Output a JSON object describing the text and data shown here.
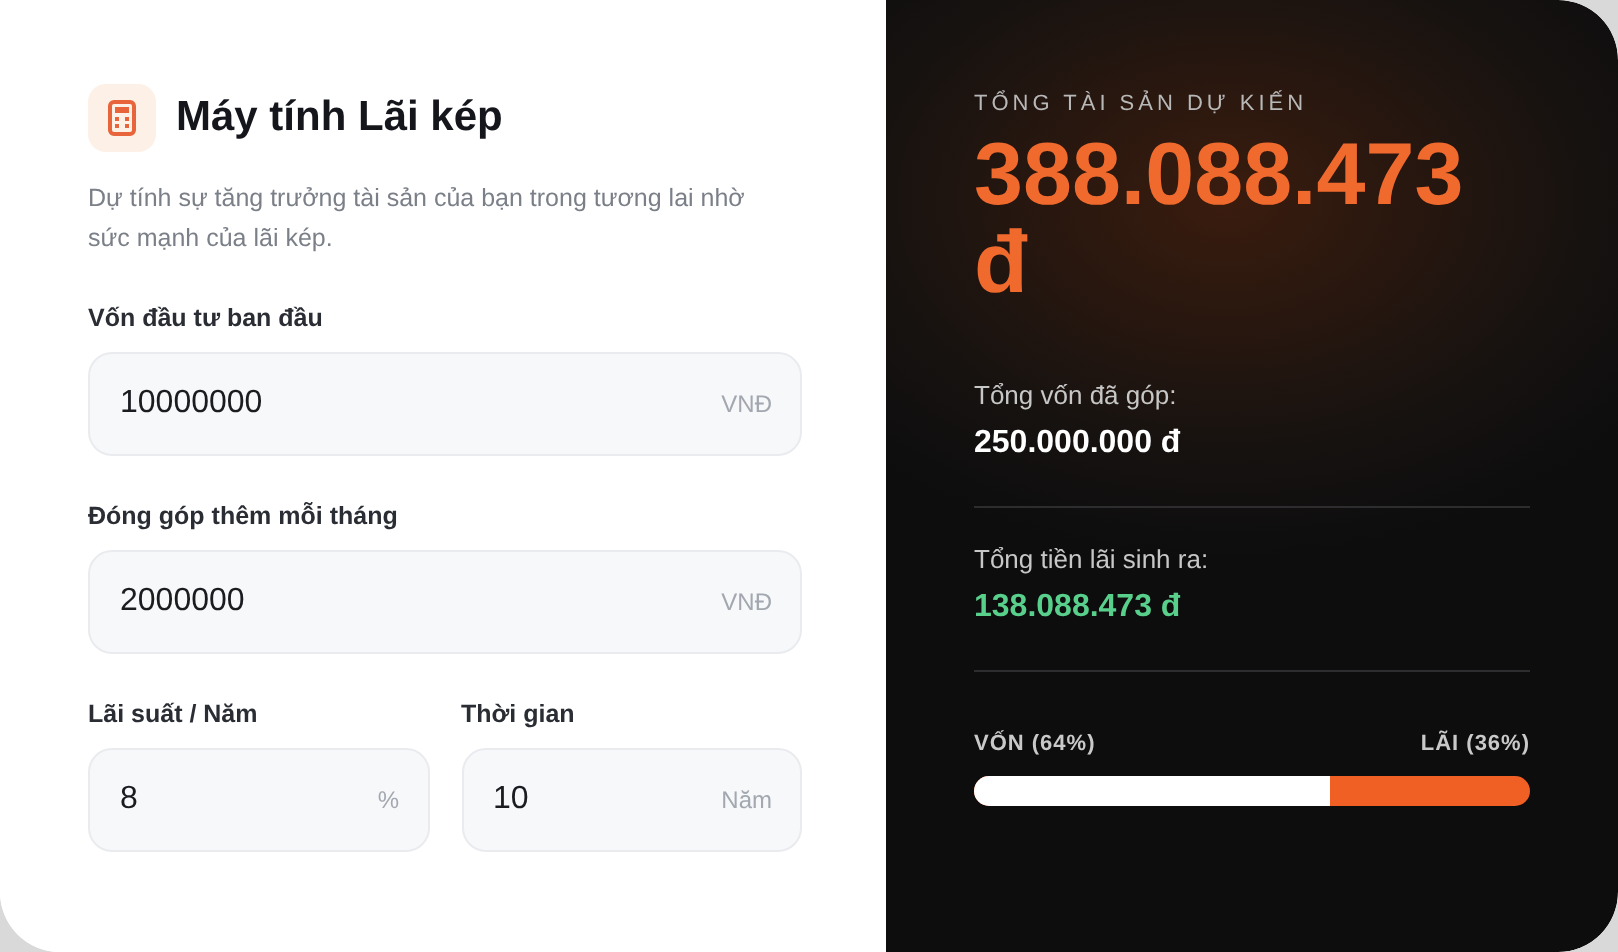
{
  "calculator": {
    "title": "Máy tính Lãi kép",
    "description": "Dự tính sự tăng trưởng tài sản của bạn trong tương lai nhờ sức mạnh của lãi kép.",
    "fields": [
      {
        "label": "Vốn đầu tư ban đầu",
        "value": "10000000",
        "unit": "VNĐ",
        "kind": "full"
      },
      {
        "label": "Đóng góp thêm mỗi tháng",
        "value": "2000000",
        "unit": "VNĐ",
        "kind": "full"
      },
      {
        "label": "Lãi suất / Năm",
        "value": "8",
        "unit": "%",
        "kind": "half"
      },
      {
        "label": "Thời gian",
        "value": "10",
        "unit": "Năm",
        "kind": "half"
      }
    ]
  },
  "result": {
    "kicker": "TỔNG TÀI SẢN DỰ KIẾN",
    "total": "388.088.473 đ",
    "stats": [
      {
        "label": "Tổng vốn đã góp:",
        "value": "250.000.000 đ",
        "kind": "principal"
      },
      {
        "label": "Tổng tiền lãi sinh ra:",
        "value": "138.088.473 đ",
        "kind": "interest"
      }
    ],
    "split": {
      "left_label": "VỐN (64%)",
      "right_label": "LÃI (36%)",
      "level": 0.64
    }
  }
}
